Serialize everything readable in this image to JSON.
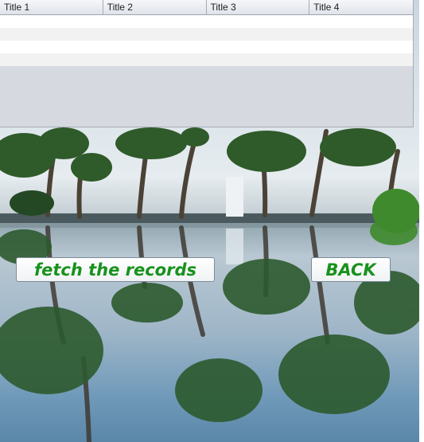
{
  "table": {
    "columns": [
      "Title 1",
      "Title 2",
      "Title 3",
      "Title 4"
    ],
    "rows": [
      [
        "",
        "",
        "",
        ""
      ],
      [
        "",
        "",
        "",
        ""
      ],
      [
        "",
        "",
        "",
        ""
      ],
      [
        "",
        "",
        "",
        ""
      ]
    ]
  },
  "buttons": {
    "fetch_label": "fetch the records",
    "back_label": "BACK"
  },
  "colors": {
    "button_text": "#18921c",
    "table_background": "#d6d9e0"
  },
  "background": {
    "icon": "palm-trees-pool-photo"
  }
}
